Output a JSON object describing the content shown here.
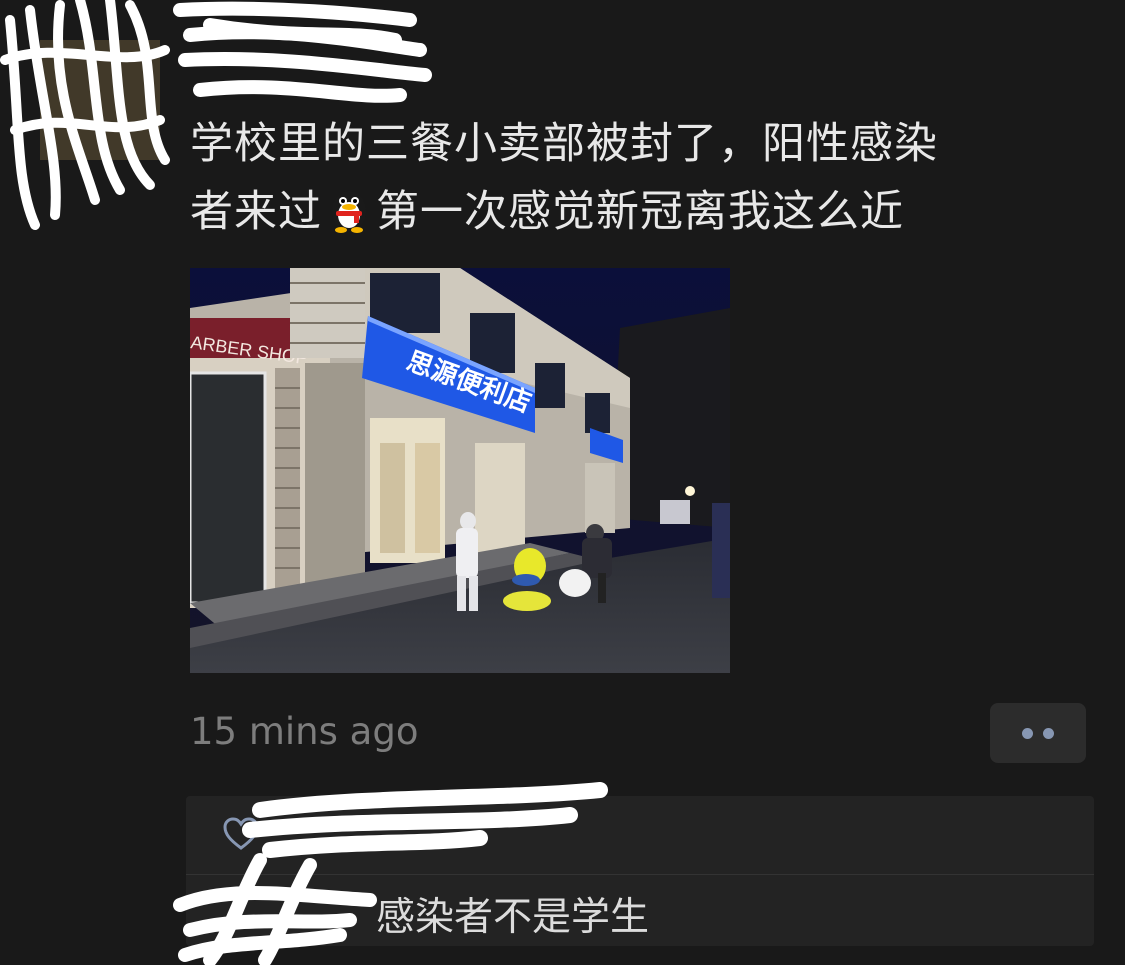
{
  "post": {
    "text_line1": "学校里的三餐小卖部被封了，阳性感染",
    "text_line2_a": "者来过",
    "text_line2_b": "第一次感觉新冠离我这么近",
    "emoji": "qq-penguin-emoji",
    "timestamp": "15 mins ago",
    "photo": {
      "store_sign": "思源便利店",
      "barber_sign": "ARBER SHOP"
    }
  },
  "actions": {
    "more_icon": "more-dots-icon"
  },
  "interactions": {
    "like_icon": "heart-icon",
    "comment_text": "感染者不是学生"
  },
  "colors": {
    "background": "#191919",
    "timestamp": "#7d7d7d",
    "accent_dots": "#8797b3"
  }
}
